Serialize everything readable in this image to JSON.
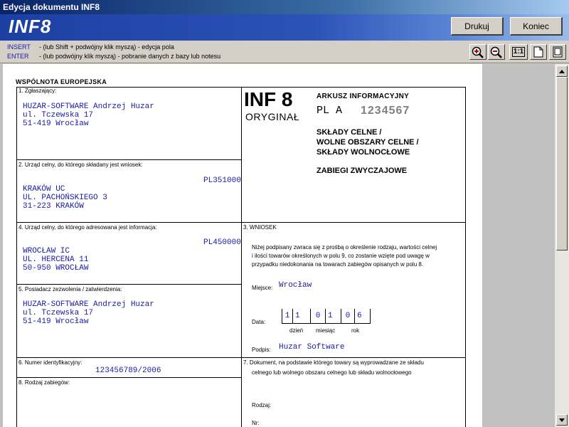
{
  "window": {
    "title": "Edycja dokumentu INF8"
  },
  "banner": {
    "logo": "INF8",
    "print_label": "Drukuj",
    "exit_label": "Koniec"
  },
  "hints": [
    {
      "key": "INSERT",
      "text": "- (lub Shift + podwójny klik myszą) - edycja pola"
    },
    {
      "key": "ENTER",
      "text": "- (lub podwójny klik myszą) - pobranie danych z bazy lub notesu"
    }
  ],
  "toolbar": {
    "actual_size": "1:1"
  },
  "form": {
    "header": "WSPÓLNOTA EUROPEJSKA",
    "doc_code": "INF 8",
    "original": "ORYGINAŁ",
    "sheet_label": "ARKUSZ INFORMACYJNY",
    "country_code": "PL  A",
    "serial": "1234567",
    "customs_lines": [
      "SKŁADY CELNE /",
      "WOLNE OBSZARY CELNE /",
      "SKŁADY WOLNOCŁOWE"
    ],
    "procedure": "ZABIEGI ZWYCZAJOWE",
    "f1": {
      "label": "1. Zgłaszający:",
      "lines": [
        "HUZAR-SOFTWARE Andrzej Huzar",
        "ul. Tczewska 17",
        "51-419 Wrocław"
      ]
    },
    "f2": {
      "label": "2. Urząd celny, do którego składany jest wniosek:",
      "code": "PL351000",
      "lines": [
        "KRAKÓW UC",
        "UL. PACHOŃSKIEGO 3",
        "31-223 KRAKÓW"
      ]
    },
    "f4": {
      "label": "4. Urząd celny, do którego adresowana jest informacja:",
      "code": "PL450000",
      "lines": [
        "WROCŁAW IC",
        "UL. HERCENA 11",
        "50-950 WROCŁAW"
      ]
    },
    "f5": {
      "label": "5. Posiadacz zezwolenia / zatwierdzenia:",
      "lines": [
        "HUZAR-SOFTWARE Andrzej Huzar",
        "ul. Tczewska 17",
        "51-419 Wrocław"
      ]
    },
    "f6": {
      "label": "6. Numer identyfikacyjny:",
      "value": "123456789/2006"
    },
    "f8": {
      "label": "8. Rodzaj zabiegów:"
    },
    "f3": {
      "label": "3. WNIOSEK",
      "text": [
        "Niżej podpisany zwraca się z prośbą o określenie rodzaju, wartości celnej",
        "i ilości towarów określonych w polu 9, co zostanie wzięte pod uwagę w",
        "przypadku niedokonania na towarach zabiegów opisanych w polu 8."
      ],
      "place_label": "Miejsce:",
      "place": "Wrocław",
      "date_label": "Data:",
      "date_digits": [
        "1",
        "1",
        "0",
        "1",
        "0",
        "6"
      ],
      "day_label": "dzień",
      "month_label": "miesiąc",
      "year_label": "rok",
      "sign_label": "Podpis:",
      "signature": "Huzar Software"
    },
    "f7": {
      "label": "7. Dokument, na podstawie którego towary są wyprowadzane ze składu",
      "label2": "celnego lub wolnego obszaru celnego lub składu wolnocłowego",
      "kind_label": "Rodzaj:",
      "nr_label": "Nr:"
    }
  }
}
